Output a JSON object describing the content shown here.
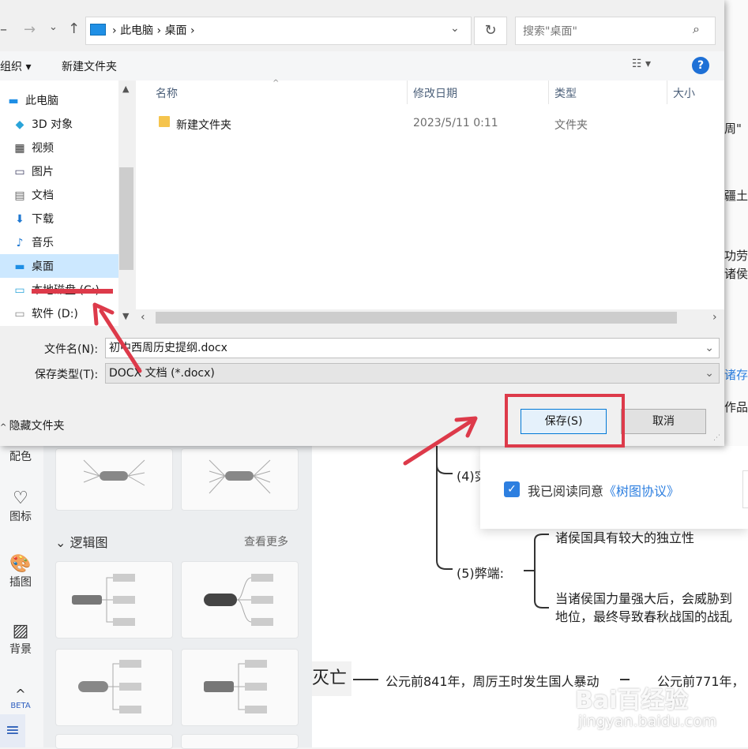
{
  "dialog": {
    "address": {
      "path": [
        "此电脑",
        "桌面"
      ]
    },
    "search_placeholder": "搜索\"桌面\"",
    "toolbar": {
      "organize": "组织 ▾",
      "new_folder": "新建文件夹"
    },
    "nav_items": [
      {
        "label": "此电脑",
        "icon": "computer-icon"
      },
      {
        "label": "3D 对象",
        "icon": "cube-icon"
      },
      {
        "label": "视频",
        "icon": "film-icon"
      },
      {
        "label": "图片",
        "icon": "picture-icon"
      },
      {
        "label": "文档",
        "icon": "document-icon"
      },
      {
        "label": "下载",
        "icon": "download-icon"
      },
      {
        "label": "音乐",
        "icon": "music-icon"
      },
      {
        "label": "桌面",
        "icon": "desktop-icon",
        "selected": true
      },
      {
        "label": "本地磁盘 (C:)",
        "icon": "drive-icon"
      },
      {
        "label": "软件 (D:)",
        "icon": "drive-icon"
      }
    ],
    "columns": {
      "name": "名称",
      "modified": "修改日期",
      "type": "类型",
      "size": "大小"
    },
    "files": [
      {
        "name": "新建文件夹",
        "modified": "2023/5/11 0:11",
        "type": "文件夹",
        "icon": "folder-icon"
      }
    ],
    "filename_label": "文件名(N):",
    "filename_value": "初中西周历史提纲.docx",
    "filetype_label": "保存类型(T):",
    "filetype_value": "DOCX 文档 (*.docx)",
    "hide_folders": "隐藏文件夹",
    "save_button": "保存(S)",
    "cancel_button": "取消"
  },
  "background": {
    "sidebar": {
      "color_label": "配色",
      "icon_label": "图标",
      "illustration_label": "插图",
      "background_label": "背景",
      "beta_label": "BETA"
    },
    "panel": {
      "logic_section": "逻辑图",
      "see_more": "查看更多"
    },
    "mindmap": {
      "node_4": "(4)实",
      "node_5": "(5)弊端:",
      "node_5_a": "诸侯国具有较大的独立性",
      "node_5_b1": "当诸侯国力量强大后，会威胁到",
      "node_5_b2": "地位，最终导致春秋战国的战乱",
      "node_destroy": "灭亡",
      "node_destroy_text": "公元前841年，周厉王时发生国人暴动",
      "node_destroy_text2": "公元前771年，"
    },
    "right_strip": [
      "周\"",
      "疆土",
      "功劳",
      "诸侯",
      "诸存",
      "作品"
    ],
    "agreement": {
      "prefix": "我已阅读同意",
      "link": "《树图协议》"
    },
    "watermark": {
      "brand": "Bai百经验",
      "url": "jingyan.baidu.com"
    }
  },
  "colors": {
    "accent": "#0078d7",
    "highlight": "#dd3a4a",
    "selected_bg": "#cce8ff"
  }
}
